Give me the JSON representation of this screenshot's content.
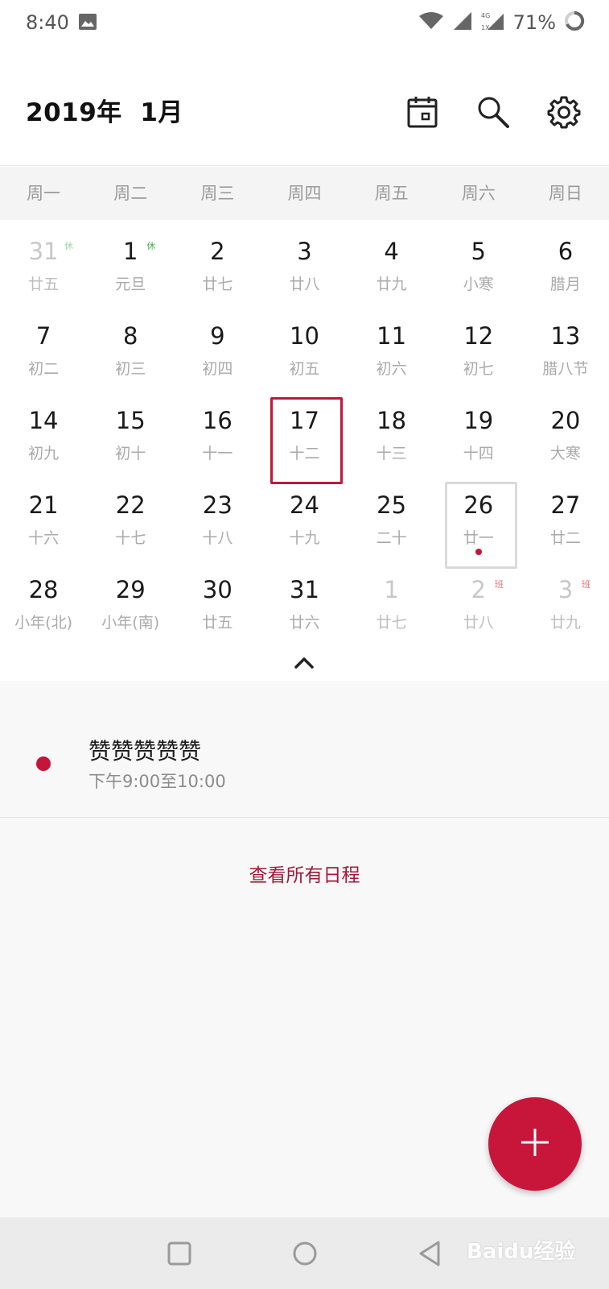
{
  "status_bar": {
    "time": "8:40",
    "battery": "71%",
    "icons": [
      "image-icon",
      "wifi-icon",
      "signal-icon",
      "network-4g-icon",
      "battery-ring-icon"
    ]
  },
  "header": {
    "title": "2019年  1月",
    "buttons": [
      "calendar-today-icon",
      "search-icon",
      "settings-gear-icon"
    ]
  },
  "week_days": [
    "周一",
    "周二",
    "周三",
    "周四",
    "周五",
    "周六",
    "周日"
  ],
  "weeks": [
    [
      {
        "day": "31",
        "lunar": "廿五",
        "dim": true,
        "tag": "休"
      },
      {
        "day": "1",
        "lunar": "元旦",
        "tag": "休"
      },
      {
        "day": "2",
        "lunar": "廿七"
      },
      {
        "day": "3",
        "lunar": "廿八"
      },
      {
        "day": "4",
        "lunar": "廿九"
      },
      {
        "day": "5",
        "lunar": "小寒"
      },
      {
        "day": "6",
        "lunar": "腊月"
      }
    ],
    [
      {
        "day": "7",
        "lunar": "初二"
      },
      {
        "day": "8",
        "lunar": "初三"
      },
      {
        "day": "9",
        "lunar": "初四"
      },
      {
        "day": "10",
        "lunar": "初五"
      },
      {
        "day": "11",
        "lunar": "初六"
      },
      {
        "day": "12",
        "lunar": "初七"
      },
      {
        "day": "13",
        "lunar": "腊八节"
      }
    ],
    [
      {
        "day": "14",
        "lunar": "初九"
      },
      {
        "day": "15",
        "lunar": "初十"
      },
      {
        "day": "16",
        "lunar": "十一"
      },
      {
        "day": "17",
        "lunar": "十二",
        "selected": true
      },
      {
        "day": "18",
        "lunar": "十三"
      },
      {
        "day": "19",
        "lunar": "十四"
      },
      {
        "day": "20",
        "lunar": "大寒"
      }
    ],
    [
      {
        "day": "21",
        "lunar": "十六"
      },
      {
        "day": "22",
        "lunar": "十七"
      },
      {
        "day": "23",
        "lunar": "十八"
      },
      {
        "day": "24",
        "lunar": "十九"
      },
      {
        "day": "25",
        "lunar": "二十"
      },
      {
        "day": "26",
        "lunar": "廿一",
        "today": true,
        "event": true
      },
      {
        "day": "27",
        "lunar": "廿二"
      }
    ],
    [
      {
        "day": "28",
        "lunar": "小年(北)"
      },
      {
        "day": "29",
        "lunar": "小年(南)"
      },
      {
        "day": "30",
        "lunar": "廿五"
      },
      {
        "day": "31",
        "lunar": "廿六"
      },
      {
        "day": "1",
        "lunar": "廿七",
        "dim": true
      },
      {
        "day": "2",
        "lunar": "廿八",
        "dim": true,
        "tag": "班"
      },
      {
        "day": "3",
        "lunar": "廿九",
        "dim": true,
        "tag": "班"
      }
    ]
  ],
  "event": {
    "title": "赞赞赞赞赞",
    "time": "下午9:00至10:00"
  },
  "view_all_label": "查看所有日程",
  "fab_icon": "plus-icon",
  "nav": [
    "recent-apps-icon",
    "home-icon",
    "back-icon"
  ],
  "watermark": "Baidu经验",
  "colors": {
    "accent": "#c2173a",
    "week_header_bg": "#f4f4f4",
    "lower_bg": "#f8f8f8"
  }
}
